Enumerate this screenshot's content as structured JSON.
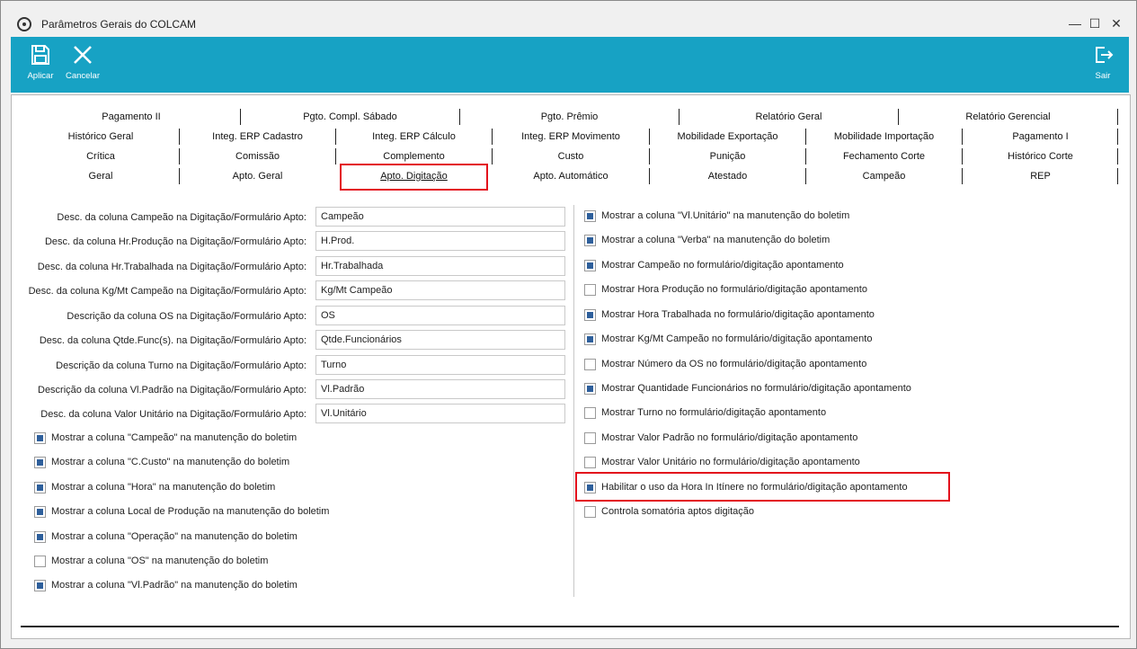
{
  "window": {
    "title": "Parâmetros Gerais do COLCAM",
    "minimize": "—",
    "maximize": "☐",
    "close": "✕"
  },
  "toolbar": {
    "apply_label": "Aplicar",
    "cancel_label": "Cancelar",
    "exit_label": "Sair",
    "color": "#17a2c4"
  },
  "tabs": {
    "row1": [
      "Pagamento II",
      "Pgto. Compl. Sábado",
      "Pgto. Prêmio",
      "Relatório Geral",
      "Relatório Gerencial"
    ],
    "row2": [
      "Histórico Geral",
      "Integ. ERP Cadastro",
      "Integ. ERP Cálculo",
      "Integ. ERP Movimento",
      "Mobilidade Exportação",
      "Mobilidade Importação",
      "Pagamento I"
    ],
    "row3": [
      "Crítica",
      "Comissão",
      "Complemento",
      "Custo",
      "Punição",
      "Fechamento Corte",
      "Histórico Corte"
    ],
    "row4": [
      "Geral",
      "Apto. Geral",
      "Apto. Digitação",
      "Apto. Automático",
      "Atestado",
      "Campeão",
      "REP"
    ],
    "active": "Apto. Digitação"
  },
  "fields": [
    {
      "label": "Desc. da coluna Campeão na Digitação/Formulário Apto:",
      "value": "Campeão"
    },
    {
      "label": "Desc. da coluna Hr.Produção na Digitação/Formulário Apto:",
      "value": "H.Prod."
    },
    {
      "label": "Desc. da coluna Hr.Trabalhada na Digitação/Formulário Apto:",
      "value": "Hr.Trabalhada"
    },
    {
      "label": "Desc. da coluna Kg/Mt Campeão na Digitação/Formulário Apto:",
      "value": "Kg/Mt Campeão"
    },
    {
      "label": "Descrição da coluna OS na Digitação/Formulário Apto:",
      "value": "OS"
    },
    {
      "label": "Desc. da coluna Qtde.Func(s). na Digitação/Formulário Apto:",
      "value": "Qtde.Funcionários"
    },
    {
      "label": "Descrição da coluna Turno na Digitação/Formulário Apto:",
      "value": "Turno"
    },
    {
      "label": "Descrição da coluna Vl.Padrão na Digitação/Formulário Apto:",
      "value": "Vl.Padrão"
    },
    {
      "label": "Desc. da coluna Valor Unitário na Digitação/Formulário Apto:",
      "value": "Vl.Unitário"
    }
  ],
  "left_checks": [
    {
      "label": "Mostrar a coluna \"Campeão\" na manutenção do boletim",
      "checked": true
    },
    {
      "label": "Mostrar a coluna \"C.Custo\" na manutenção do boletim",
      "checked": true
    },
    {
      "label": "Mostrar a coluna \"Hora\" na manutenção do boletim",
      "checked": true
    },
    {
      "label": "Mostrar a coluna Local de Produção na manutenção do boletim",
      "checked": true
    },
    {
      "label": "Mostrar a coluna \"Operação\" na manutenção do boletim",
      "checked": true
    },
    {
      "label": "Mostrar a coluna \"OS\" na manutenção do boletim",
      "checked": false
    },
    {
      "label": "Mostrar a coluna \"Vl.Padrão\" na manutenção do boletim",
      "checked": true
    }
  ],
  "right_checks": [
    {
      "label": "Mostrar a coluna \"Vl.Unitário\" na manutenção do boletim",
      "checked": true
    },
    {
      "label": "Mostrar a coluna \"Verba\" na manutenção do boletim",
      "checked": true
    },
    {
      "label": "Mostrar Campeão no formulário/digitação apontamento",
      "checked": true
    },
    {
      "label": "Mostrar Hora Produção no formulário/digitação apontamento",
      "checked": false
    },
    {
      "label": "Mostrar Hora Trabalhada no formulário/digitação apontamento",
      "checked": true
    },
    {
      "label": "Mostrar Kg/Mt Campeão no formulário/digitação apontamento",
      "checked": true
    },
    {
      "label": "Mostrar Número da OS no formulário/digitação apontamento",
      "checked": false
    },
    {
      "label": "Mostrar Quantidade Funcionários no formulário/digitação apontamento",
      "checked": true
    },
    {
      "label": "Mostrar Turno no formulário/digitação apontamento",
      "checked": false
    },
    {
      "label": "Mostrar Valor Padrão no formulário/digitação apontamento",
      "checked": false
    },
    {
      "label": "Mostrar Valor Unitário no formulário/digitação apontamento",
      "checked": false
    },
    {
      "label": "Habilitar o uso da Hora In Itínere no formulário/digitação apontamento",
      "checked": true
    },
    {
      "label": "Controla somatória aptos digitação",
      "checked": false
    }
  ]
}
